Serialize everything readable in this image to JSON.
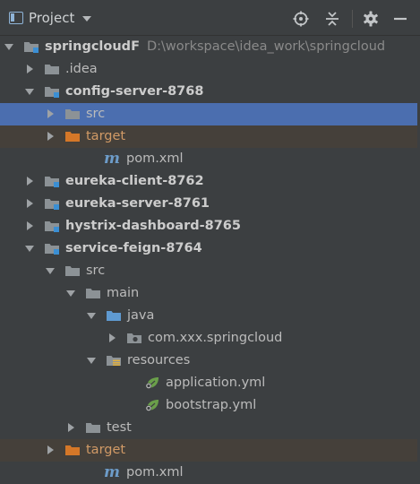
{
  "header": {
    "title": "Project"
  },
  "colors": {
    "panel_bg": "#3c3f41",
    "selected_row": "#4b6eaf",
    "excluded_row": "#45403a",
    "folder_grey": "#8c9296",
    "folder_blue": "#5f9ad1",
    "folder_orange": "#d57728"
  },
  "tree": [
    {
      "id": "springcloudF",
      "label": "springcloudF",
      "path": "D:\\workspace\\idea_work\\springcloud",
      "icon": "module-folder-icon",
      "arrow": "down",
      "bold": true
    },
    {
      "id": "idea",
      "label": ".idea",
      "icon": "folder-icon",
      "arrow": "right"
    },
    {
      "id": "config-server",
      "label": "config-server-8768",
      "icon": "module-folder-icon",
      "arrow": "down",
      "bold": true
    },
    {
      "id": "config-src",
      "label": "src",
      "icon": "folder-icon",
      "arrow": "right",
      "selected": true
    },
    {
      "id": "config-target",
      "label": "target",
      "icon": "excluded-folder-icon",
      "arrow": "right",
      "excluded": true
    },
    {
      "id": "config-pom",
      "label": "pom.xml",
      "icon": "maven-icon",
      "arrow": "none"
    },
    {
      "id": "eureka-client",
      "label": "eureka-client-8762",
      "icon": "module-folder-icon",
      "arrow": "right",
      "bold": true
    },
    {
      "id": "eureka-server",
      "label": "eureka-server-8761",
      "icon": "module-folder-icon",
      "arrow": "right",
      "bold": true
    },
    {
      "id": "hystrix",
      "label": "hystrix-dashboard-8765",
      "icon": "module-folder-icon",
      "arrow": "right",
      "bold": true
    },
    {
      "id": "service-feign",
      "label": "service-feign-8764",
      "icon": "module-folder-icon",
      "arrow": "down",
      "bold": true
    },
    {
      "id": "feign-src",
      "label": "src",
      "icon": "folder-icon",
      "arrow": "down"
    },
    {
      "id": "feign-main",
      "label": "main",
      "icon": "folder-icon",
      "arrow": "down"
    },
    {
      "id": "feign-java",
      "label": "java",
      "icon": "source-folder-icon",
      "arrow": "down"
    },
    {
      "id": "feign-package",
      "label": "com.xxx.springcloud",
      "icon": "package-icon",
      "arrow": "right"
    },
    {
      "id": "feign-resources",
      "label": "resources",
      "icon": "resources-folder-icon",
      "arrow": "down"
    },
    {
      "id": "feign-app-yml",
      "label": "application.yml",
      "icon": "spring-yml-icon",
      "arrow": "none"
    },
    {
      "id": "feign-bootstrap-yml",
      "label": "bootstrap.yml",
      "icon": "spring-yml-icon",
      "arrow": "none"
    },
    {
      "id": "feign-test",
      "label": "test",
      "icon": "folder-icon",
      "arrow": "right"
    },
    {
      "id": "feign-target",
      "label": "target",
      "icon": "excluded-folder-icon",
      "arrow": "right",
      "excluded": true
    },
    {
      "id": "feign-pom",
      "label": "pom.xml",
      "icon": "maven-icon",
      "arrow": "none"
    }
  ]
}
